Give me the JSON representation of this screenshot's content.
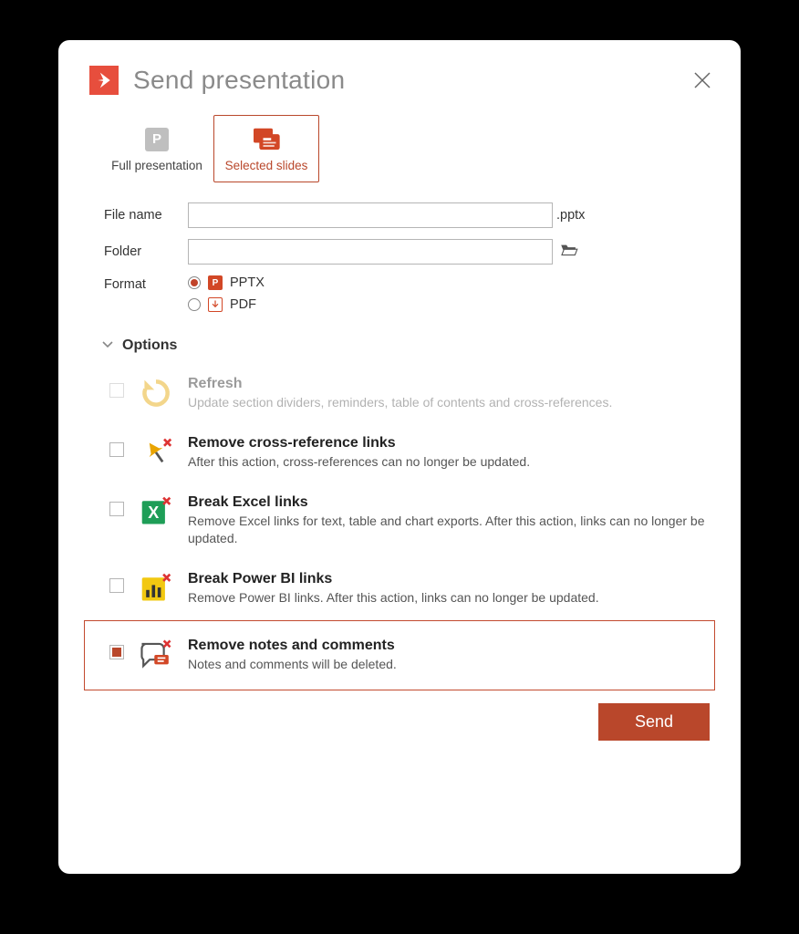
{
  "header": {
    "title": "Send presentation"
  },
  "tabs": {
    "full": "Full presentation",
    "selected": "Selected slides"
  },
  "form": {
    "filename_label": "File name",
    "filename_value": "",
    "filename_suffix": ".pptx",
    "folder_label": "Folder",
    "folder_value": "",
    "format_label": "Format",
    "pptx_label": "PPTX",
    "pdf_label": "PDF"
  },
  "options_header": "Options",
  "options": {
    "refresh": {
      "title": "Refresh",
      "desc": "Update section dividers, reminders, table of contents and cross-references."
    },
    "crossref": {
      "title": "Remove cross-reference links",
      "desc": "After this action, cross-references can no longer be updated."
    },
    "excel": {
      "title": "Break Excel links",
      "desc": "Remove Excel links for text, table and chart exports. After this action, links can no longer be updated."
    },
    "powerbi": {
      "title": "Break Power BI links",
      "desc": "Remove Power BI links. After this action, links can no longer be updated."
    },
    "notes": {
      "title": "Remove notes and comments",
      "desc": "Notes and comments will be deleted."
    }
  },
  "footer": {
    "send": "Send"
  }
}
